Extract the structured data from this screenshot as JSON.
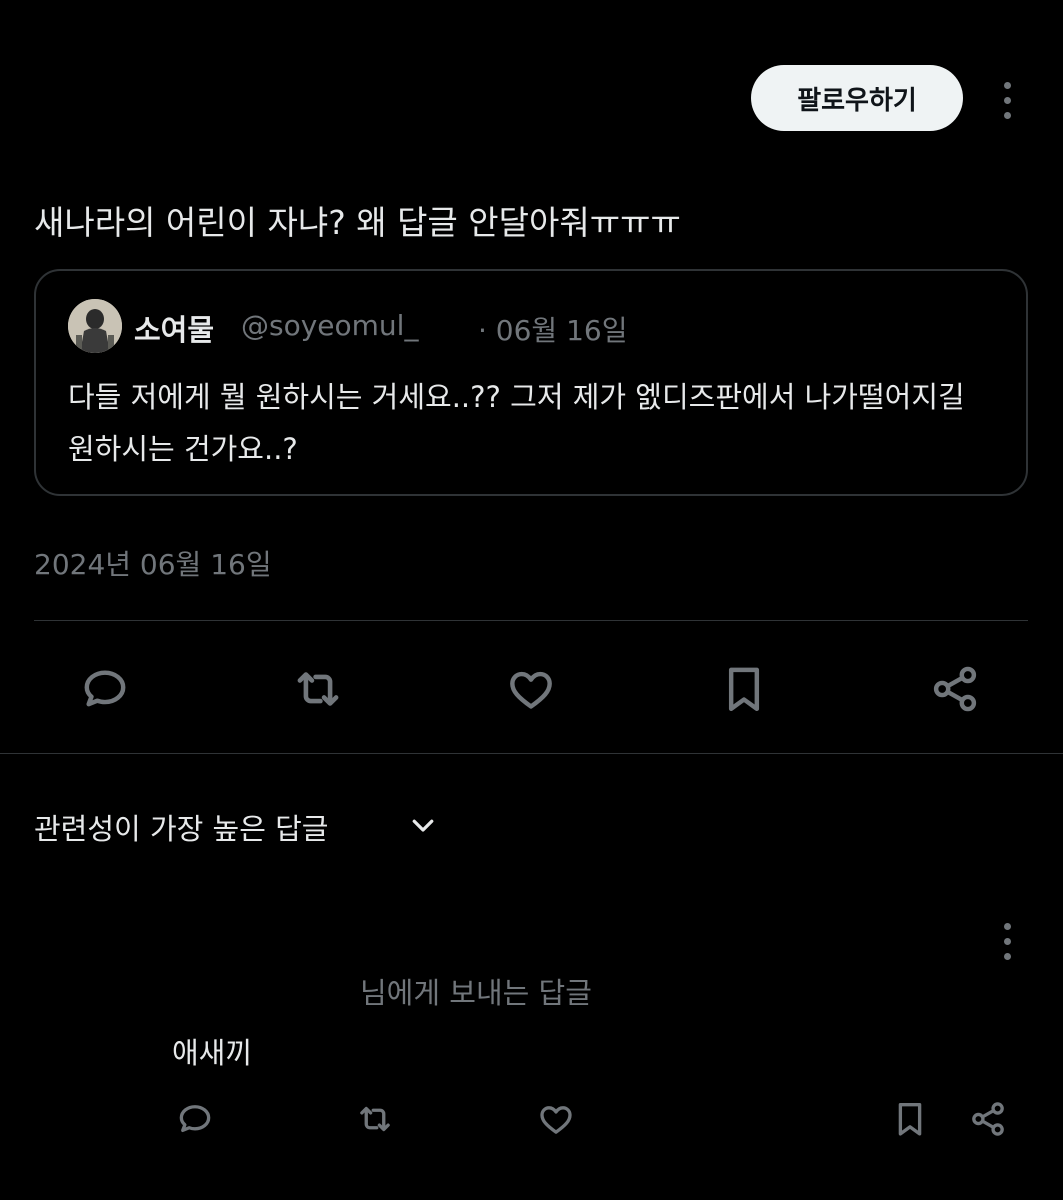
{
  "header": {
    "follow_label": "팔로우하기",
    "more_icon": "more-vertical-icon"
  },
  "post": {
    "text": "새나라의 어린이 자냐? 왜 답글 안달아줘ㅠㅠㅠ",
    "quote": {
      "name": "소여물",
      "handle": "@soyeomul_",
      "date": "· 06월 16일",
      "body": "다들 저에게 뭘 원하시는 거세요..?? 그저 제가 엜디즈판에서 나가떨어지길 원하시는 건가요..?"
    },
    "timestamp": "2024년 06월 16일",
    "actions": [
      "reply-icon",
      "retweet-icon",
      "like-icon",
      "bookmark-icon",
      "share-icon"
    ]
  },
  "replies": {
    "sort_label": "관련성이 가장 높은 답글",
    "sort_icon": "chevron-down-icon",
    "reply": {
      "context": "님에게 보내는 답글",
      "text": "애새끼",
      "actions": [
        "reply-icon",
        "retweet-icon",
        "like-icon",
        "bookmark-icon",
        "share-icon"
      ]
    }
  },
  "colors": {
    "background": "#000000",
    "text": "#e7e9ea",
    "muted": "#71767b",
    "border": "#2f3336",
    "follow_bg": "#eff3f4"
  }
}
